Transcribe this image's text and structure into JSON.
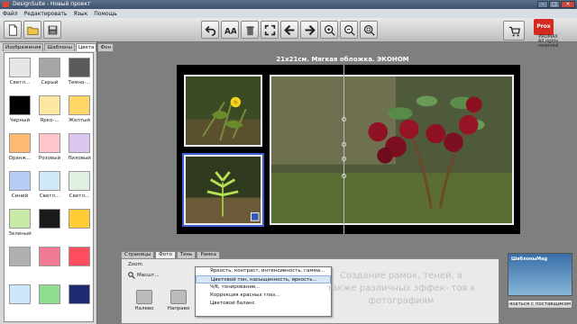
{
  "window": {
    "title": "DesignSuite - Новый проект",
    "controls": [
      "–",
      "□",
      "×"
    ]
  },
  "menu": [
    "Файл",
    "Редактировать",
    "Язык",
    "Помощь"
  ],
  "brand": {
    "logo": "Prox",
    "name": "PROMAX",
    "rights": "All rights reserved"
  },
  "left_tabs": [
    "Изображения",
    "Шаблоны",
    "Цвета",
    "Фон"
  ],
  "left_active_tab": 2,
  "swatches": [
    {
      "label": "Светл...",
      "color": "#e6e6e6"
    },
    {
      "label": "Серый",
      "color": "#a6a6a6"
    },
    {
      "label": "Темно-...",
      "color": "#5a5a5a"
    },
    {
      "label": "Черный",
      "color": "#000000"
    },
    {
      "label": "Ярко-...",
      "color": "#fbe7a3"
    },
    {
      "label": "Желтый",
      "color": "#ffd766"
    },
    {
      "label": "Оранж...",
      "color": "#ffb870"
    },
    {
      "label": "Розовый",
      "color": "#ffc4cc"
    },
    {
      "label": "Лиловый",
      "color": "#dcc6f0"
    },
    {
      "label": "Синий",
      "color": "#b8cdf5"
    },
    {
      "label": "Светл...",
      "color": "#cfe9f7"
    },
    {
      "label": "Светл...",
      "color": "#dff0e0"
    },
    {
      "label": "Зеленый",
      "color": "#c8eaa6"
    },
    {
      "label": "",
      "color": "#1a1a1a"
    },
    {
      "label": "",
      "color": "#ffcc33"
    },
    {
      "label": "",
      "color": "#b0b0b0"
    },
    {
      "label": "",
      "color": "#f07a93"
    },
    {
      "label": "",
      "color": "#ff4d5e"
    },
    {
      "label": "",
      "color": "#cce6fb"
    },
    {
      "label": "",
      "color": "#8fdc8f"
    },
    {
      "label": "",
      "color": "#1f2a70"
    }
  ],
  "project_title": "21x21см. Мягкая обложка. ЭКОНОМ",
  "bottom_tabs": [
    "Страницы",
    "Фото",
    "Тень",
    "Рамка"
  ],
  "bottom_active_tab": 1,
  "zoom": {
    "label": "Zoom",
    "field": "Масшт..."
  },
  "actions": [
    "Налево",
    "Направо"
  ],
  "context_menu": [
    "Яркость, контраст, интенсивность, гамма...",
    "Цветовой тон, насыщенность, яркость...",
    "Ч/б, тонирование...",
    "Коррекция красных глаз...",
    "Цветовой баланс"
  ],
  "context_hover": 1,
  "overlay_caption": "Создание рамок, теней, а также различных эффек- тов к фотографиям",
  "supplier": {
    "title": "ШаблоныMag",
    "button": "язаться с поставщиком"
  },
  "colors": {
    "titlebar": "#3e5270",
    "page_bg": "#000000",
    "accent_red": "#d42a20"
  }
}
